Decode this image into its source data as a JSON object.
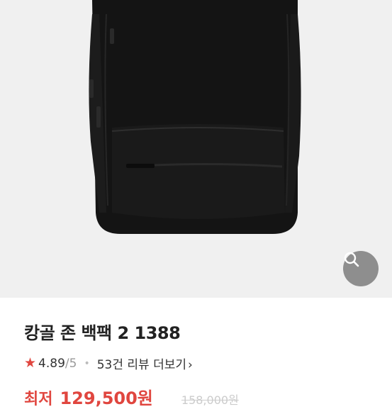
{
  "product": {
    "title": "캉골 존 백팩 2 1388",
    "image_alt": "black backpack product photo"
  },
  "rating": {
    "star_icon": "★",
    "score": "4.89",
    "out_of": "/5",
    "separator": "•",
    "reviews_link": "53건 리뷰 더보기",
    "chevron": "›"
  },
  "price": {
    "label": "최저",
    "value": "129,500원",
    "original": "158,000원"
  },
  "zoom": {
    "icon": "search-icon"
  },
  "colors": {
    "accent": "#e0463f",
    "image_bg": "#f0f0f0",
    "bag": "#141414"
  }
}
